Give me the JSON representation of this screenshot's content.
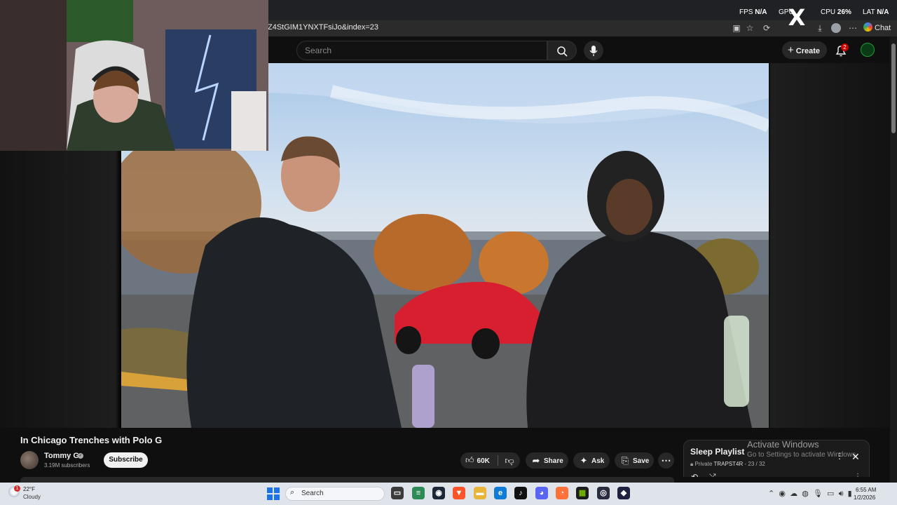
{
  "browser": {
    "url": "Z4StGIM1YNXTFsiJo&index=23",
    "chat_label": "Chat"
  },
  "perf_overlay": {
    "fps_label": "FPS",
    "fps_value": "N/A",
    "gpu_label": "GPU",
    "cpu_label": "CPU",
    "cpu_value": "26%",
    "lat_label": "LAT",
    "lat_value": "N/A"
  },
  "youtube_header": {
    "search_placeholder": "Search",
    "create_label": "Create",
    "notification_count": "2"
  },
  "video": {
    "title": "In Chicago Trenches with Polo G",
    "channel_name": "Tommy G",
    "subscribers": "3.19M subscribers",
    "subscribe_label": "Subscribe",
    "likes": "60K",
    "share_label": "Share",
    "ask_label": "Ask",
    "save_label": "Save"
  },
  "playlist": {
    "title": "Sleep Playlist",
    "privacy": "Private",
    "owner": "TRAPST4R",
    "position": "23 / 32"
  },
  "windows_watermark": {
    "title": "Activate Windows",
    "subtitle": "Go to Settings to activate Windows."
  },
  "taskbar": {
    "temperature": "22°F",
    "condition": "Cloudy",
    "weather_badge": "1",
    "search_placeholder": "Search",
    "time": "6:55 AM",
    "date": "1/2/2026"
  }
}
